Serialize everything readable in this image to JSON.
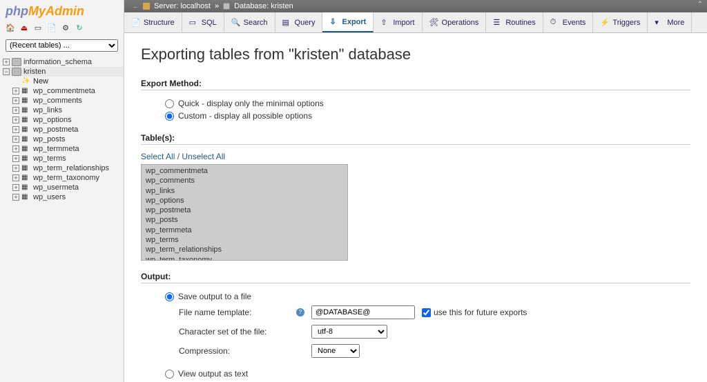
{
  "logo": {
    "part1": "php",
    "part2": "My",
    "part3": "Admin"
  },
  "recent_tables_placeholder": "(Recent tables) ...",
  "tree": {
    "databases": [
      {
        "name": "information_schema",
        "expanded": false
      },
      {
        "name": "kristen",
        "expanded": true,
        "selected": true,
        "tables": [
          "wp_commentmeta",
          "wp_comments",
          "wp_links",
          "wp_options",
          "wp_postmeta",
          "wp_posts",
          "wp_termmeta",
          "wp_terms",
          "wp_term_relationships",
          "wp_term_taxonomy",
          "wp_usermeta",
          "wp_users"
        ],
        "new_label": "New"
      }
    ]
  },
  "breadcrumb": {
    "server_label": "Server:",
    "server_value": "localhost",
    "db_label": "Database:",
    "db_value": "kristen"
  },
  "tabs": [
    {
      "key": "structure",
      "label": "Structure",
      "icon": "📄"
    },
    {
      "key": "sql",
      "label": "SQL",
      "icon": "▭"
    },
    {
      "key": "search",
      "label": "Search",
      "icon": "🔍"
    },
    {
      "key": "query",
      "label": "Query",
      "icon": "▤"
    },
    {
      "key": "export",
      "label": "Export",
      "icon": "⇩",
      "active": true
    },
    {
      "key": "import",
      "label": "Import",
      "icon": "⇧"
    },
    {
      "key": "operations",
      "label": "Operations",
      "icon": "🛠"
    },
    {
      "key": "routines",
      "label": "Routines",
      "icon": "☰"
    },
    {
      "key": "events",
      "label": "Events",
      "icon": "⏱"
    },
    {
      "key": "triggers",
      "label": "Triggers",
      "icon": "⚡"
    },
    {
      "key": "more",
      "label": "More",
      "icon": "▾",
      "more": true
    }
  ],
  "page_title": "Exporting tables from \"kristen\" database",
  "export_method": {
    "heading": "Export Method:",
    "options": [
      {
        "key": "quick",
        "label": "Quick - display only the minimal options",
        "checked": false
      },
      {
        "key": "custom",
        "label": "Custom - display all possible options",
        "checked": true
      }
    ]
  },
  "tables_section": {
    "heading": "Table(s):",
    "select_all": "Select All",
    "separator": " / ",
    "unselect_all": "Unselect All",
    "list": [
      "wp_commentmeta",
      "wp_comments",
      "wp_links",
      "wp_options",
      "wp_postmeta",
      "wp_posts",
      "wp_termmeta",
      "wp_terms",
      "wp_term_relationships",
      "wp_term_taxonomy"
    ]
  },
  "output": {
    "heading": "Output:",
    "save_file": {
      "label": "Save output to a file",
      "checked": true
    },
    "filename_label": "File name template:",
    "filename_value": "@DATABASE@",
    "future_label": "use this for future exports",
    "future_checked": true,
    "charset_label": "Character set of the file:",
    "charset_value": "utf-8",
    "compression_label": "Compression:",
    "compression_value": "None",
    "view_text": {
      "label": "View output as text",
      "checked": false
    }
  }
}
